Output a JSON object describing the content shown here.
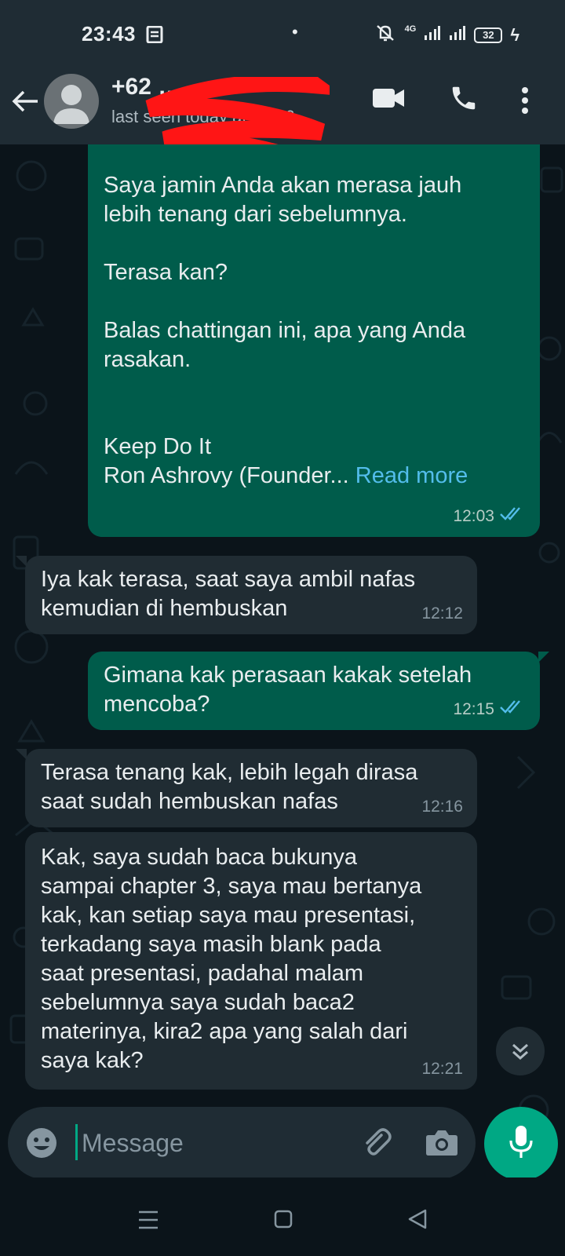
{
  "status_bar": {
    "time": "23:43",
    "network": "4G",
    "battery": "32"
  },
  "header": {
    "contact_name": "+62 …",
    "contact_status": "last seen today at 23:36"
  },
  "messages": [
    {
      "direction": "out",
      "text": "Saya jamin Anda akan merasa jauh\nlebih tenang dari sebelumnya.\n\nTerasa kan?\n\nBalas chattingan ini, apa yang Anda\nrasakan.\n\n\nKeep Do It\nRon Ashrovy (Founder... ",
      "read_more": "Read more",
      "time": "12:03"
    },
    {
      "direction": "in",
      "text": "Iya kak terasa, saat saya ambil nafas\nkemudian di hembuskan",
      "time": "12:12"
    },
    {
      "direction": "out",
      "text": "Gimana kak perasaan kakak setelah\nmencoba?",
      "time": "12:15"
    },
    {
      "direction": "in",
      "text": "Terasa tenang kak, lebih legah dirasa\nsaat sudah hembuskan nafas",
      "time": "12:16"
    },
    {
      "direction": "in",
      "text": "Kak, saya sudah baca bukunya\nsampai chapter 3, saya mau bertanya\nkak, kan setiap saya mau presentasi,\nterkadang saya masih blank pada\nsaat presentasi, padahal malam\nsebelumnya saya sudah baca2\nmaterinya, kira2 apa yang salah dari\nsaya kak?",
      "time": "12:21"
    }
  ],
  "input": {
    "placeholder": "Message"
  },
  "colors": {
    "header_bg": "#1f2c34",
    "chat_bg": "#0b141a",
    "outgoing_bubble": "#005c4b",
    "incoming_bubble": "#202c33",
    "accent": "#00a884",
    "read_ticks": "#53bdeb"
  },
  "icons": {
    "header": [
      "back-arrow-icon",
      "video-call-icon",
      "phone-icon",
      "more-vert-icon"
    ],
    "input": [
      "emoji-icon",
      "attach-icon",
      "camera-icon",
      "mic-icon"
    ],
    "navigation": [
      "nav-menu-icon",
      "nav-home-icon",
      "nav-back-icon"
    ]
  }
}
